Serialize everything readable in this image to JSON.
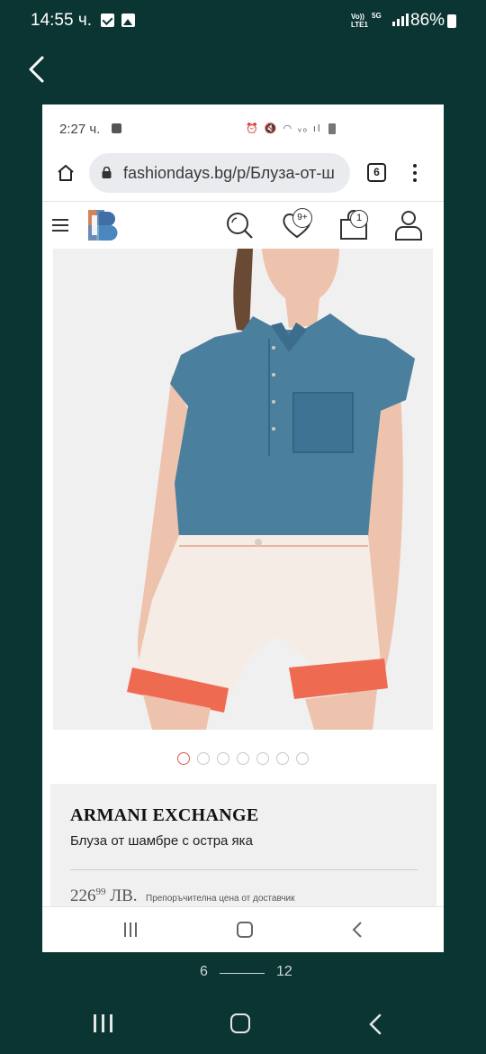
{
  "outer_status": {
    "time": "14:55 ч.",
    "network_label": "Vo)) LTE1",
    "network_type": "5G",
    "battery": "86%"
  },
  "inner_status": {
    "time": "2:27 ч."
  },
  "browser": {
    "url": "fashiondays.bg/p/Блуза-от-ш",
    "tab_count": "6"
  },
  "site_header": {
    "wishlist_badge": "9+",
    "cart_badge": "1"
  },
  "carousel": {
    "image_count": 7,
    "active_index": 0
  },
  "product": {
    "brand": "ARMANI EXCHANGE",
    "title": "Блуза от шамбре с остра яка",
    "price_main": "226",
    "price_cents": "99",
    "price_currency": "ЛВ.",
    "price_note": "Препоръчителна цена от доставчик"
  },
  "gallery_pager": {
    "current": "6",
    "total": "12"
  },
  "colors": {
    "background": "#0b3532",
    "accent_dot": "#e05a4b",
    "info_bg": "#f0f0f0"
  }
}
